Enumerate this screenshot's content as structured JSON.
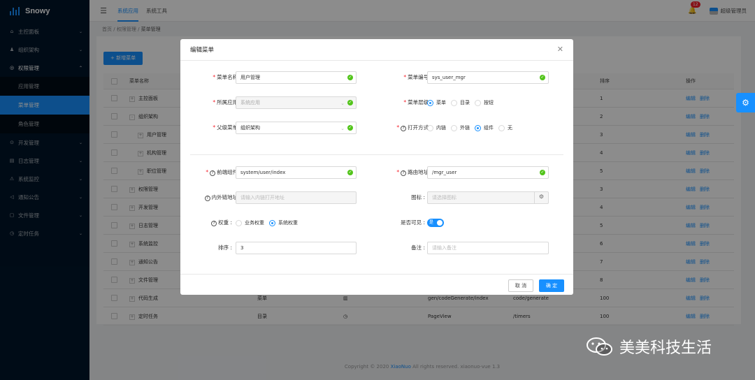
{
  "app": {
    "name": "Snowy"
  },
  "sidebar": {
    "items": [
      {
        "label": "主控面板",
        "icon": "home-icon",
        "glyph": "⌂"
      },
      {
        "label": "组织架构",
        "icon": "org-icon",
        "glyph": "♟"
      },
      {
        "label": "权限管理",
        "icon": "shield-icon",
        "glyph": "◎"
      },
      {
        "label": "开发管理",
        "icon": "dev-icon",
        "glyph": "⊙"
      },
      {
        "label": "日志管理",
        "icon": "log-icon",
        "glyph": "▤"
      },
      {
        "label": "系统监控",
        "icon": "monitor-icon",
        "glyph": "⚠"
      },
      {
        "label": "通知公告",
        "icon": "notice-icon",
        "glyph": "◁"
      },
      {
        "label": "文件管理",
        "icon": "file-icon",
        "glyph": "▢"
      },
      {
        "label": "定时任务",
        "icon": "clock-icon",
        "glyph": "◷"
      }
    ],
    "submenu": [
      {
        "label": "应用管理"
      },
      {
        "label": "菜单管理"
      },
      {
        "label": "角色管理"
      }
    ]
  },
  "header": {
    "tabs": [
      "系统应用",
      "系统工具"
    ],
    "notification_count": "12",
    "user_name": "超级管理员"
  },
  "breadcrumb": {
    "home": "首页",
    "sep": "/",
    "parent": "权限管理",
    "current": "菜单管理"
  },
  "table": {
    "new_button": "+ 新增菜单",
    "columns": [
      "菜单名称",
      "排序",
      "操作"
    ],
    "rows": [
      {
        "name": "主控面板",
        "expand": "+",
        "indent": 0,
        "type": "",
        "icon": "",
        "component": "",
        "route": "",
        "sort": "1"
      },
      {
        "name": "组织架构",
        "expand": "-",
        "indent": 0,
        "type": "",
        "icon": "",
        "component": "",
        "route": "",
        "sort": "2"
      },
      {
        "name": "用户管理",
        "expand": "+",
        "indent": 1,
        "type": "",
        "icon": "",
        "component": "",
        "route": "",
        "sort": "3"
      },
      {
        "name": "机构管理",
        "expand": "+",
        "indent": 1,
        "type": "",
        "icon": "",
        "component": "",
        "route": "",
        "sort": "4"
      },
      {
        "name": "职位管理",
        "expand": "+",
        "indent": 1,
        "type": "",
        "icon": "",
        "component": "",
        "route": "",
        "sort": "5"
      },
      {
        "name": "权限管理",
        "expand": "+",
        "indent": 0,
        "type": "",
        "icon": "",
        "component": "",
        "route": "",
        "sort": "3"
      },
      {
        "name": "开发管理",
        "expand": "+",
        "indent": 0,
        "type": "",
        "icon": "",
        "component": "",
        "route": "",
        "sort": "4"
      },
      {
        "name": "日志管理",
        "expand": "+",
        "indent": 0,
        "type": "",
        "icon": "",
        "component": "",
        "route": "",
        "sort": "5"
      },
      {
        "name": "系统监控",
        "expand": "+",
        "indent": 0,
        "type": "",
        "icon": "",
        "component": "",
        "route": "",
        "sort": "6"
      },
      {
        "name": "通知公告",
        "expand": "+",
        "indent": 0,
        "type": "",
        "icon": "",
        "component": "",
        "route": "",
        "sort": "7"
      },
      {
        "name": "文件管理",
        "expand": "+",
        "indent": 0,
        "type": "",
        "icon": "",
        "component": "",
        "route": "",
        "sort": "8"
      },
      {
        "name": "代码生成",
        "expand": "+",
        "indent": 0,
        "type": "菜单",
        "icon": "▥",
        "component": "gen/codeGenerate/index",
        "route": "code/generate",
        "sort": "100"
      },
      {
        "name": "定时任务",
        "expand": "+",
        "indent": 0,
        "type": "目录",
        "icon": "◷",
        "component": "PageView",
        "route": "/timers",
        "sort": "100"
      }
    ],
    "actions": {
      "edit": "编辑",
      "delete": "删除"
    }
  },
  "footer": {
    "copyright": "Copyright © 2020",
    "brand": "XiaoNuo",
    "rest": "All rights reserved. xiaonuo-vue 1.3"
  },
  "modal": {
    "title": "编辑菜单",
    "fields": {
      "name": {
        "label": "菜单名称 :",
        "value": "用户管理"
      },
      "code": {
        "label": "菜单编号 :",
        "value": "sys_user_mgr"
      },
      "app": {
        "label": "所属应用 :",
        "value": "系统应用"
      },
      "level": {
        "label": "菜单层级 :",
        "options": [
          "菜单",
          "目录",
          "按钮"
        ],
        "selected": "菜单"
      },
      "parent": {
        "label": "父级菜单 :",
        "value": "组织架构"
      },
      "open_type": {
        "label": "打开方式 :",
        "options": [
          "内链",
          "外链",
          "组件",
          "无"
        ],
        "selected": "组件"
      },
      "component": {
        "label": "前端组件 :",
        "value": "system/user/index"
      },
      "route": {
        "label": "路由地址 :",
        "value": "/mgr_user"
      },
      "link": {
        "label": "内外链地址 :",
        "placeholder": "请输入内链打开地址"
      },
      "icon": {
        "label": "图标 :",
        "placeholder": "请选择图标"
      },
      "weight": {
        "label": "权重 :",
        "options": [
          "业务权重",
          "系统权重"
        ],
        "selected": "系统权重"
      },
      "visible": {
        "label": "是否可见 :",
        "switch_text": "是",
        "value": true
      },
      "sort": {
        "label": "排序 :",
        "value": "3"
      },
      "remark": {
        "label": "备注 :",
        "placeholder": "请输入备注"
      }
    },
    "cancel": "取 消",
    "ok": "确 定"
  },
  "watermark": {
    "text": "美美科技生活"
  },
  "colors": {
    "primary": "#1890ff",
    "sidebar": "#001529",
    "success": "#52c41a",
    "danger": "#f5222d"
  }
}
